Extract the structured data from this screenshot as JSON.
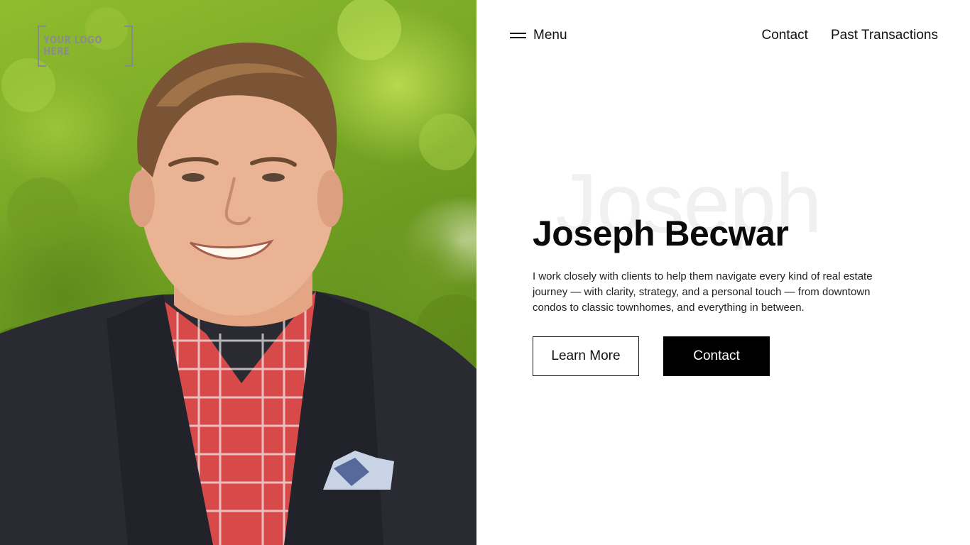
{
  "logo": {
    "text": "YOUR LOGO HERE"
  },
  "nav": {
    "menu_label": "Menu",
    "links": [
      "Contact",
      "Past Transactions"
    ]
  },
  "hero": {
    "ghost_text": "Joseph",
    "name": "Joseph Becwar",
    "description": "I work closely with clients to help them navigate every kind of real estate journey — with clarity, strategy, and a personal touch — from downtown condos to classic townhomes, and everything in between.",
    "primary_button": "Learn More",
    "secondary_button": "Contact"
  },
  "colors": {
    "text": "#111111",
    "ghost_text": "#f0f0f0",
    "button_solid_bg": "#000000",
    "photo_background": "#7aa626"
  },
  "icons": {
    "menu": "hamburger-icon"
  }
}
